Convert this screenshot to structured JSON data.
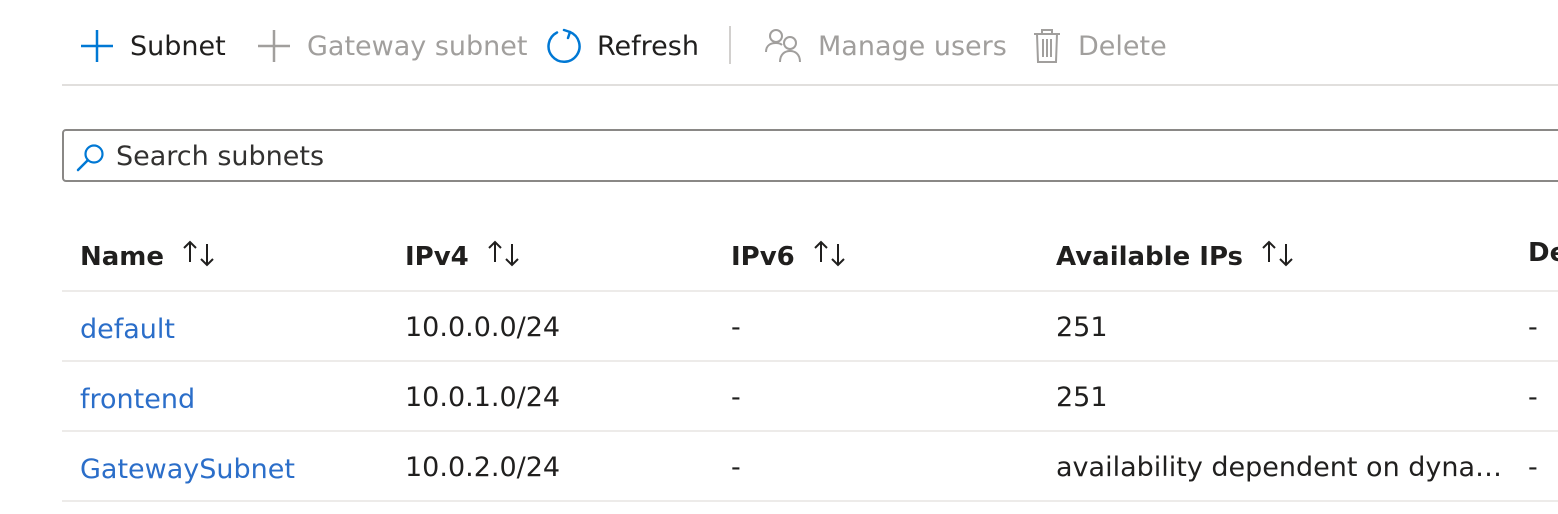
{
  "toolbar": {
    "subnet_label": "Subnet",
    "gateway_subnet_label": "Gateway subnet",
    "refresh_label": "Refresh",
    "manage_users_label": "Manage users",
    "delete_label": "Delete"
  },
  "search": {
    "placeholder": "Search subnets",
    "value": ""
  },
  "table": {
    "columns": [
      "Name",
      "IPv4",
      "IPv6",
      "Available IPs",
      "De"
    ],
    "rows": [
      {
        "name": "default",
        "ipv4": "10.0.0.0/24",
        "ipv6": "-",
        "available_ips": "251",
        "col5": "-"
      },
      {
        "name": "frontend",
        "ipv4": "10.0.1.0/24",
        "ipv6": "-",
        "available_ips": "251",
        "col5": "-"
      },
      {
        "name": "GatewaySubnet",
        "ipv4": "10.0.2.0/24",
        "ipv6": "-",
        "available_ips": "availability dependent on dynamic…",
        "col5": "-"
      }
    ]
  },
  "colors": {
    "accent": "#0078d4",
    "link": "#2b6ec9",
    "disabled": "#a19f9d"
  }
}
